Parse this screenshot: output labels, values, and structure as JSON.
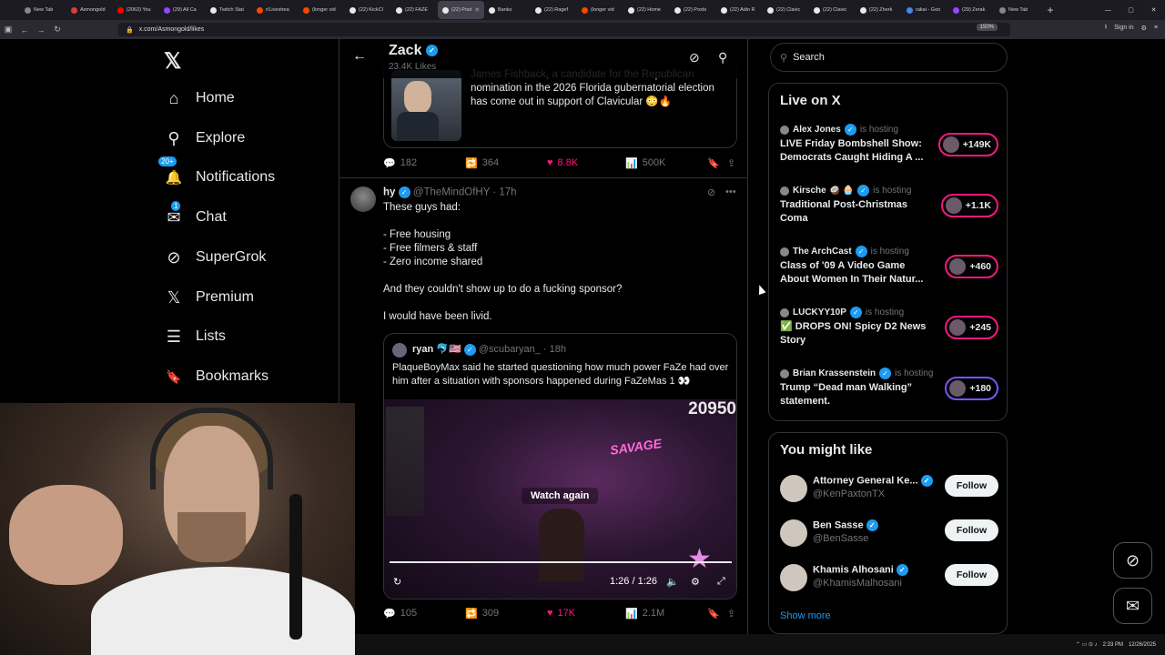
{
  "browser": {
    "tabs": [
      {
        "title": "New Tab",
        "color": "#888888"
      },
      {
        "title": "Asmongold",
        "color": "#e03a3a"
      },
      {
        "title": "(2063) You",
        "color": "#ff0000"
      },
      {
        "title": "(29) All Ca",
        "color": "#9146ff"
      },
      {
        "title": "Twitch Stat",
        "color": "#e7e9ea"
      },
      {
        "title": "r/Livestrea",
        "color": "#ff4500"
      },
      {
        "title": "(longer vid",
        "color": "#ff4500"
      },
      {
        "title": "(22) KickCl",
        "color": "#e7e9ea"
      },
      {
        "title": "(22) FAZE",
        "color": "#e7e9ea"
      },
      {
        "title": "(22) Post",
        "color": "#e7e9ea",
        "active": true
      },
      {
        "title": "Banks",
        "color": "#e7e9ea"
      },
      {
        "title": "(22) Ragef",
        "color": "#e7e9ea"
      },
      {
        "title": "(longer vid",
        "color": "#ff4500"
      },
      {
        "title": "(22) Home",
        "color": "#e7e9ea"
      },
      {
        "title": "(22) Posts",
        "color": "#e7e9ea"
      },
      {
        "title": "(22) Adin R",
        "color": "#e7e9ea"
      },
      {
        "title": "(22) Clavic",
        "color": "#e7e9ea"
      },
      {
        "title": "(22) Clavic",
        "color": "#e7e9ea"
      },
      {
        "title": "(22) Zherk",
        "color": "#e7e9ea"
      },
      {
        "title": "rakai - Goo",
        "color": "#4285f4"
      },
      {
        "title": "(29) Zerak",
        "color": "#9146ff"
      },
      {
        "title": "New Tab",
        "color": "#888888"
      }
    ],
    "url": "x.com/Asmongold/likes",
    "zoom": "150%",
    "signin": "Sign in"
  },
  "nav": {
    "logo": "𝕏",
    "items": [
      {
        "label": "Home",
        "icon": "⌂"
      },
      {
        "label": "Explore",
        "icon": "⚲"
      },
      {
        "label": "Notifications",
        "icon": "🔔",
        "badge": "20+"
      },
      {
        "label": "Chat",
        "icon": "✉",
        "badge": "1"
      },
      {
        "label": "SuperGrok",
        "icon": "⊘"
      },
      {
        "label": "Premium",
        "icon": "𝕏"
      },
      {
        "label": "Lists",
        "icon": "☰"
      },
      {
        "label": "Bookmarks",
        "icon": "🔖"
      }
    ]
  },
  "feed": {
    "header": {
      "name": "Zack",
      "likes": "23.4K Likes"
    },
    "quote1": {
      "text": "James Fishback, a candidate for the Republican nomination in the 2026 Florida gubernatorial election has come out in support of Clavicular 😳🔥"
    },
    "actions1": {
      "replies": "182",
      "reposts": "364",
      "likes": "8.8K",
      "views": "500K"
    },
    "tweet2": {
      "name": "hy",
      "handle": "@TheMindOfHY",
      "time": "· 17h",
      "body": "These guys had:\n\n- Free housing\n- Free filmers & staff\n- Zero income shared\n\nAnd they couldn't show up to do a fucking sponsor?\n\nI would have been livid.",
      "quote": {
        "name": "ryan 🐬🇺🇸",
        "handle": "@scubaryan_",
        "time": "· 18h",
        "text": "PlaqueBoyMax said he started questioning how much power FaZe had over him after a situation with sponsors happened during FaZeMas 1 👀",
        "video": {
          "counter": "20950",
          "watch_again": "Watch again",
          "time": "1:26 / 1:26",
          "neon": "SAVAGE"
        }
      }
    },
    "actions2": {
      "replies": "105",
      "reposts": "309",
      "likes": "17K",
      "views": "2.1M"
    }
  },
  "right": {
    "search_placeholder": "Search",
    "live_title": "Live on X",
    "hosting_text": "is hosting",
    "live": [
      {
        "host": "Alex Jones",
        "title": "LIVE Friday Bombshell Show: Democrats Caught Hiding A ...",
        "count": "+149K"
      },
      {
        "host": "Kirsche 🥥 🧁",
        "title": "Traditional Post-Christmas Coma",
        "count": "+1.1K"
      },
      {
        "host": "The ArchCast",
        "title": "Class of '09 A Video Game About Women In Their Natur...",
        "count": "+460"
      },
      {
        "host": "LUCKYY10P",
        "title": "✅ DROPS ON! Spicy D2 News Story",
        "count": "+245"
      },
      {
        "host": "Brian Krassenstein",
        "title": "Trump “Dead man Walking” statement.",
        "count": "+180"
      }
    ],
    "wtf_title": "You might like",
    "follow": [
      {
        "name": "Attorney General Ke...",
        "handle": "@KenPaxtonTX"
      },
      {
        "name": "Ben Sasse",
        "handle": "@BenSasse"
      },
      {
        "name": "Khamis Alhosani",
        "handle": "@KhamisMalhosani"
      }
    ],
    "follow_label": "Follow",
    "show_more": "Show more"
  },
  "taskbar": {
    "time": "2:33 PM",
    "date": "12/26/2025"
  }
}
